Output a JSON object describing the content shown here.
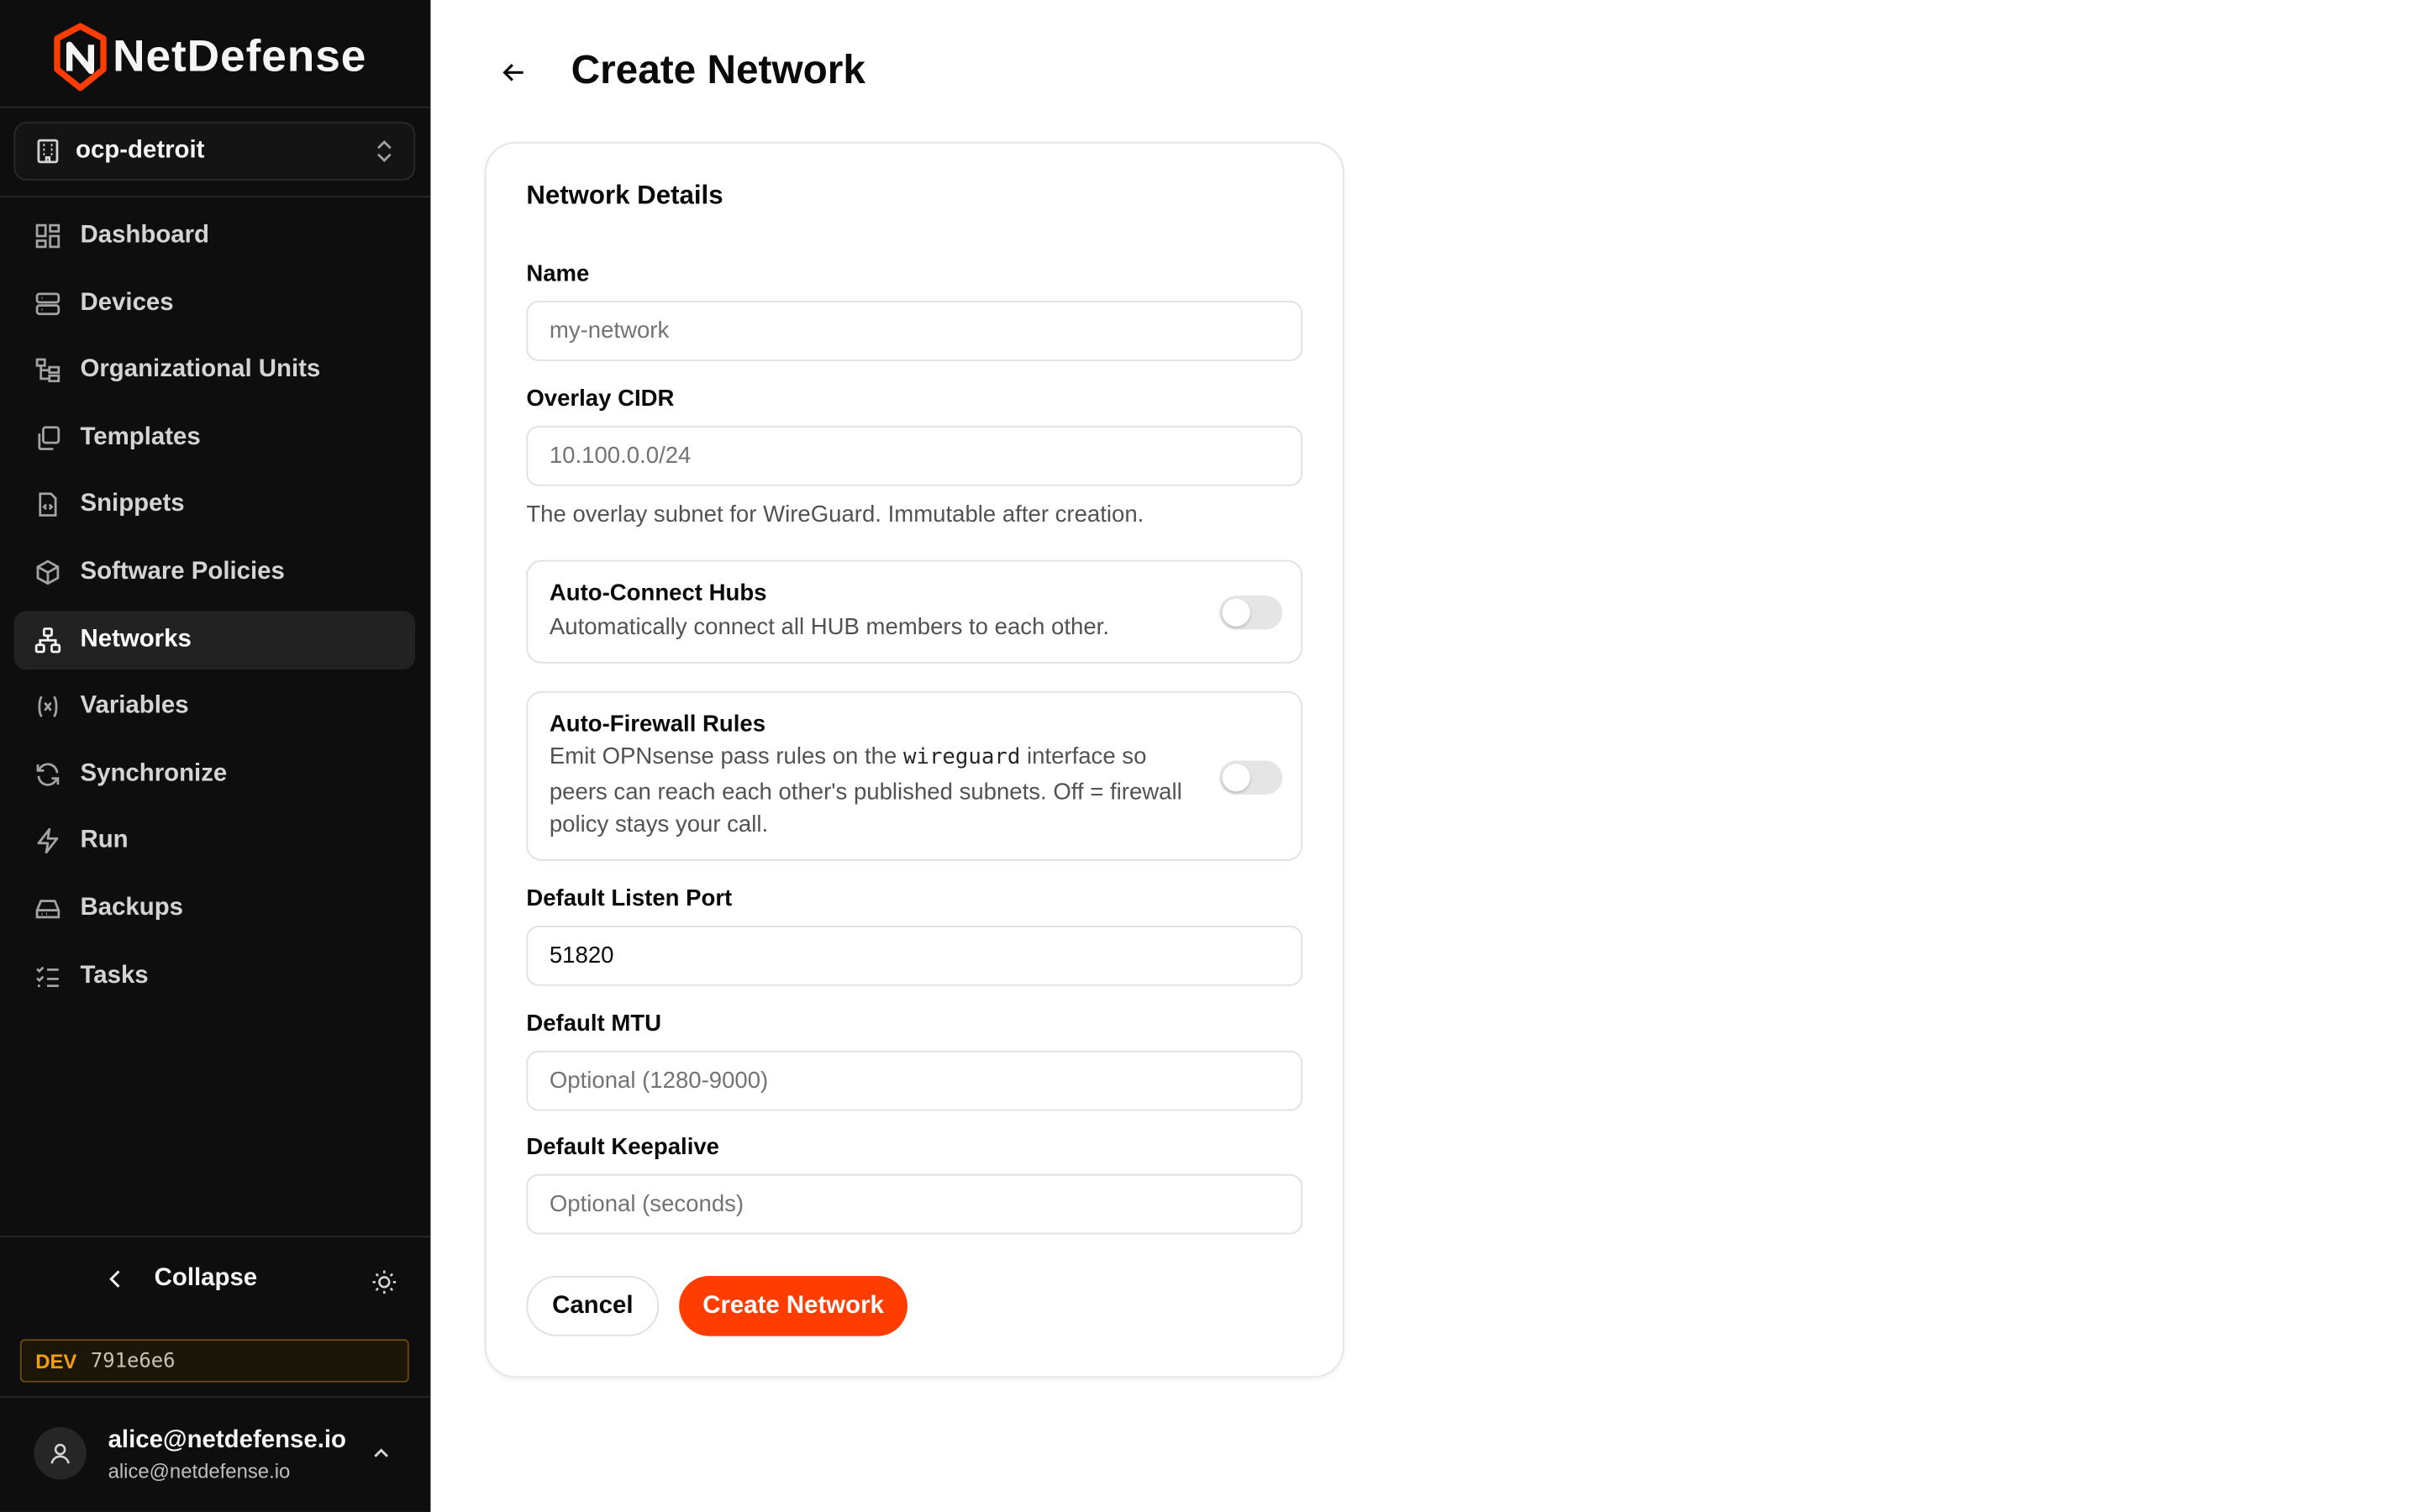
{
  "brand": {
    "name": "NetDefense",
    "accent": "#ff3d00"
  },
  "org_selector": {
    "value": "ocp-detroit",
    "icon": "building-icon"
  },
  "nav": [
    {
      "label": "Dashboard",
      "icon": "dashboard-icon",
      "active": false
    },
    {
      "label": "Devices",
      "icon": "server-icon",
      "active": false
    },
    {
      "label": "Organizational Units",
      "icon": "tree-icon",
      "active": false
    },
    {
      "label": "Templates",
      "icon": "copy-icon",
      "active": false
    },
    {
      "label": "Snippets",
      "icon": "file-code-icon",
      "active": false
    },
    {
      "label": "Software Policies",
      "icon": "package-icon",
      "active": false
    },
    {
      "label": "Networks",
      "icon": "network-icon",
      "active": true
    },
    {
      "label": "Variables",
      "icon": "variable-icon",
      "active": false
    },
    {
      "label": "Synchronize",
      "icon": "refresh-icon",
      "active": false
    },
    {
      "label": "Run",
      "icon": "zap-icon",
      "active": false
    },
    {
      "label": "Backups",
      "icon": "hard-drive-icon",
      "active": false
    },
    {
      "label": "Tasks",
      "icon": "list-checks-icon",
      "active": false
    }
  ],
  "sidebar_footer": {
    "collapse_label": "Collapse",
    "env_badge": "DEV",
    "build_hash": "791e6e6",
    "user_name": "alice@netdefense.io",
    "user_email": "alice@netdefense.io"
  },
  "page": {
    "title": "Create Network",
    "card_title": "Network Details",
    "fields": {
      "name": {
        "label": "Name",
        "placeholder": "my-network",
        "value": ""
      },
      "overlay_cidr": {
        "label": "Overlay CIDR",
        "placeholder": "10.100.0.0/24",
        "value": "",
        "help": "The overlay subnet for WireGuard. Immutable after creation."
      },
      "listen_port": {
        "label": "Default Listen Port",
        "value": "51820"
      },
      "mtu": {
        "label": "Default MTU",
        "placeholder": "Optional (1280-9000)",
        "value": ""
      },
      "keepalive": {
        "label": "Default Keepalive",
        "placeholder": "Optional (seconds)",
        "value": ""
      }
    },
    "toggles": {
      "auto_connect": {
        "title": "Auto-Connect Hubs",
        "description": "Automatically connect all HUB members to each other.",
        "enabled": false
      },
      "auto_firewall": {
        "title": "Auto-Firewall Rules",
        "desc_before": "Emit OPNsense pass rules on the ",
        "desc_code": "wireguard",
        "desc_after": " interface so peers can reach each other's published subnets. Off = firewall policy stays your call.",
        "enabled": false
      }
    },
    "buttons": {
      "cancel": "Cancel",
      "submit": "Create Network"
    }
  }
}
